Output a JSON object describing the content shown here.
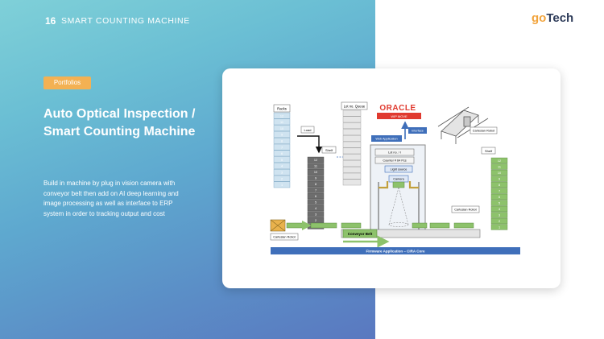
{
  "header": {
    "page_number": "16",
    "title": "SMART COUNTING MACHINE"
  },
  "logo": {
    "part1": "go",
    "part2": "Tech"
  },
  "hero": {
    "badge": "Portfolios",
    "title": "Auto Optical Inspection / Smart Counting Machine",
    "description": "Build in machine by plug in vision camera with conveyor belt then add on AI deep learning and image processing as well as interface to ERP system in order to tracking output and cost"
  },
  "diagram": {
    "racks": "Racks",
    "lot_queue": "Lot no. Queue",
    "oracle": "ORACLE",
    "wip_move": "WIP MOVE",
    "interface": "Interface",
    "web_application": "Web Application",
    "cartesian_robot_top": "Cartesian Robot",
    "load": "Load",
    "shelf_left": "Shelf",
    "shelf_right": "Shelf",
    "lot_no": "Lot no. / I",
    "counter": "Counter # 64 Pcs",
    "light_source": "Light source",
    "camera": "Camera",
    "cartesian_robot_right": "Cartesian Robot",
    "cartesian_robot_left": "Cartesian Robot",
    "conveyor_belt": "Conveyor Belt",
    "firmware": "Firmware Application – CIRA Core",
    "stack_numbers": [
      "12",
      "11",
      "10",
      "9",
      "8",
      "7",
      "6",
      "5",
      "4",
      "3",
      "2",
      "1"
    ]
  },
  "colors": {
    "accent_orange": "#f3b153",
    "oracle_red": "#e03a2f",
    "firmware_blue": "#3f6fba",
    "green": "#8dc26b",
    "dark_stack": "#6d6d6d",
    "light_blue_rack": "#cfe3f0"
  }
}
